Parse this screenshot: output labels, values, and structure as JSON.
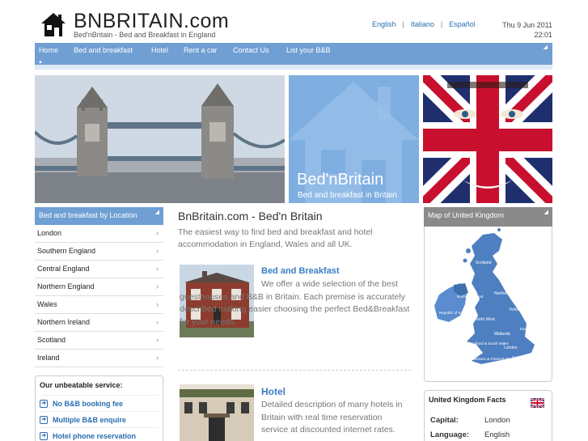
{
  "header": {
    "brand": "BNBRITAIN.com",
    "tagline": "Bed'nBritain - Bed and Breakfast in England",
    "languages": [
      "English",
      "Italiano",
      "Español"
    ],
    "date": "Thu 9 Jun 2011",
    "time": "22:01"
  },
  "nav": {
    "items": [
      "Home",
      "Bed and breakfast",
      "Hotel",
      "Rent a car",
      "Contact Us",
      "List your B&B"
    ]
  },
  "hero": {
    "title": "Bed'nBritain",
    "subtitle": "Bed and breakfast in Britain"
  },
  "locations": {
    "heading": "Bed and breakfast by Location",
    "items": [
      "London",
      "Southern England",
      "Central England",
      "Northern England",
      "Wales",
      "Northern Ireland",
      "Scotland",
      "Ireland"
    ]
  },
  "service": {
    "heading": "Our unbeatable service:",
    "items": [
      "No B&B booking fee",
      "Multiple B&B enquire",
      "Hotel phone reservation"
    ]
  },
  "main": {
    "title": "BnBritain.com - Bed'n Britain",
    "intro": "The easiest way to find bed and breakfast and hotel accommodation in England, Wales and all UK.",
    "features": [
      {
        "title": "Bed and Breakfast",
        "text": "We offer a wide selection of the best guesthouses and B&B in Britain. Each premise is accurately described making easier choosing the perfect Bed&Breakfast for your needs."
      },
      {
        "title": "Hotel",
        "text": "Detailed description of many hotels in Britain with real time reservation service at discounted internet rates."
      }
    ]
  },
  "map": {
    "heading": "Map of United Kingdom",
    "labels": {
      "scotland": "Scotland",
      "northern_ireland": "Northern Ireland",
      "republic_ireland": "Republic of Ireland",
      "northern": "Northern",
      "yorkshire": "Yorkshire",
      "north_west": "North West",
      "midlands": "Midlands",
      "east_anglia": "East Anglia",
      "west_england": "West of England & South Wales",
      "london": "London",
      "kent": "Kent, Surrey & Sussex",
      "wessex": "Wessex & Channel Isles"
    }
  },
  "facts": {
    "heading": "United Kingdom Facts",
    "rows": [
      {
        "key": "Capital:",
        "value": "London"
      },
      {
        "key": "Language:",
        "value": "English"
      }
    ]
  },
  "colors": {
    "nav": "#6f9fd3",
    "link": "#3a7fc4",
    "map_land": "#4d7fc1"
  }
}
